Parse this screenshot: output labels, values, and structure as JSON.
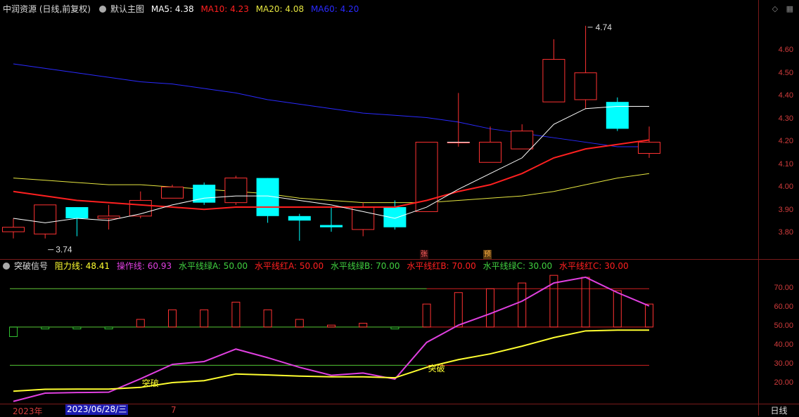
{
  "main_header": {
    "stock": "中润资源 (日线,前复权)",
    "template": "默认主图",
    "ma5": "MA5: 4.38",
    "ma10": "MA10: 4.23",
    "ma20": "MA20: 4.08",
    "ma60": "MA60: 4.20"
  },
  "indicator_header": {
    "name": "突破信号",
    "resistance": "阻力线: 48.41",
    "operation": "操作线: 60.93",
    "h_green_a": "水平线绿A: 50.00",
    "h_red_a": "水平线红A: 50.00",
    "h_green_b": "水平线绿B: 70.00",
    "h_red_b": "水平线红B: 70.00",
    "h_green_c": "水平线绿C: 30.00",
    "h_red_c": "水平线红C: 30.00"
  },
  "price_axis": [
    "4.60",
    "4.50",
    "4.40",
    "4.30",
    "4.20",
    "4.10",
    "4.00",
    "3.90",
    "3.80"
  ],
  "indicator_axis": [
    "70.00",
    "60.00",
    "50.00",
    "40.00",
    "30.00",
    "20.00"
  ],
  "annotations": {
    "high": "4.74",
    "low": "3.74",
    "breakout_1": "突破",
    "breakout_2": "突破"
  },
  "badges": {
    "rise": "张",
    "forecast": "预"
  },
  "bottom": {
    "year": "2023年",
    "cursor_date": "2023/06/28/三",
    "month": "7",
    "period": "日线"
  },
  "colors": {
    "ma5": "#ffffff",
    "ma10": "#ff2020",
    "ma20": "#e6e640",
    "ma60": "#2a2aff",
    "up": "#ff3232",
    "down": "#00ffff",
    "operation": "#e040e0",
    "resistance": "#ffff30"
  },
  "icons": {
    "settings": "diamond-icon",
    "layout": "grid-icon"
  },
  "chart_data": {
    "type": "candlestick",
    "candles": [
      {
        "o": 3.82,
        "h": 3.88,
        "l": 3.79,
        "c": 3.84
      },
      {
        "o": 3.81,
        "h": 3.94,
        "l": 3.79,
        "c": 3.94
      },
      {
        "o": 3.93,
        "h": 3.93,
        "l": 3.8,
        "c": 3.88
      },
      {
        "o": 3.88,
        "h": 3.94,
        "l": 3.83,
        "c": 3.89
      },
      {
        "o": 3.89,
        "h": 4.0,
        "l": 3.88,
        "c": 3.96
      },
      {
        "o": 3.97,
        "h": 4.03,
        "l": 3.97,
        "c": 4.02
      },
      {
        "o": 4.03,
        "h": 4.04,
        "l": 3.94,
        "c": 3.95
      },
      {
        "o": 3.95,
        "h": 4.07,
        "l": 3.94,
        "c": 4.06
      },
      {
        "o": 4.06,
        "h": 4.06,
        "l": 3.86,
        "c": 3.89
      },
      {
        "o": 3.89,
        "h": 3.9,
        "l": 3.78,
        "c": 3.87
      },
      {
        "o": 3.85,
        "h": 3.93,
        "l": 3.82,
        "c": 3.84
      },
      {
        "o": 3.83,
        "h": 3.95,
        "l": 3.8,
        "c": 3.93
      },
      {
        "o": 3.93,
        "h": 3.96,
        "l": 3.83,
        "c": 3.84
      },
      {
        "o": 3.91,
        "h": 4.22,
        "l": 3.91,
        "c": 4.22
      },
      {
        "o": 4.22,
        "h": 4.44,
        "l": 4.2,
        "c": 4.22
      },
      {
        "o": 4.13,
        "h": 4.29,
        "l": 4.13,
        "c": 4.22
      },
      {
        "o": 4.19,
        "h": 4.3,
        "l": 4.19,
        "c": 4.27
      },
      {
        "o": 4.4,
        "h": 4.68,
        "l": 4.4,
        "c": 4.59
      },
      {
        "o": 4.41,
        "h": 4.74,
        "l": 4.37,
        "c": 4.53
      },
      {
        "o": 4.4,
        "h": 4.42,
        "l": 4.27,
        "c": 4.28
      },
      {
        "o": 4.17,
        "h": 4.29,
        "l": 4.15,
        "c": 4.22
      }
    ],
    "ma5": [
      3.88,
      3.86,
      3.88,
      3.87,
      3.9,
      3.94,
      3.97,
      3.98,
      3.98,
      3.96,
      3.94,
      3.91,
      3.88,
      3.93,
      4.01,
      4.08,
      4.15,
      4.3,
      4.37,
      4.38,
      4.38
    ],
    "ma10": [
      4.0,
      3.98,
      3.96,
      3.95,
      3.94,
      3.93,
      3.92,
      3.93,
      3.93,
      3.93,
      3.93,
      3.93,
      3.93,
      3.96,
      4.0,
      4.03,
      4.08,
      4.15,
      4.19,
      4.21,
      4.23
    ],
    "ma20": [
      4.06,
      4.05,
      4.04,
      4.03,
      4.03,
      4.02,
      4.01,
      4.0,
      3.99,
      3.97,
      3.96,
      3.95,
      3.95,
      3.95,
      3.96,
      3.97,
      3.98,
      4.0,
      4.03,
      4.06,
      4.08
    ],
    "ma60": [
      4.57,
      4.55,
      4.53,
      4.51,
      4.49,
      4.48,
      4.46,
      4.44,
      4.41,
      4.39,
      4.37,
      4.35,
      4.34,
      4.33,
      4.31,
      4.28,
      4.26,
      4.24,
      4.22,
      4.2,
      4.2
    ],
    "ylim": [
      3.72,
      4.78
    ],
    "indicator": {
      "histogram": [
        45,
        49,
        49,
        49,
        54,
        59,
        59,
        63,
        59,
        54,
        51,
        52,
        49,
        62,
        68,
        70,
        73,
        77,
        76,
        69,
        62
      ],
      "operation_line": [
        11.2,
        15.5,
        15.8,
        16.0,
        23.0,
        30.5,
        32.0,
        38.5,
        34.0,
        29.0,
        24.8,
        26.0,
        22.8,
        42.0,
        51.0,
        57.0,
        63.5,
        73.0,
        76.0,
        68.0,
        61.0
      ],
      "resistance_line": [
        16.5,
        17.5,
        17.6,
        17.6,
        18.5,
        21.0,
        22.0,
        25.5,
        25.0,
        24.4,
        24.0,
        24.0,
        23.5,
        29.0,
        33.0,
        36.0,
        40.0,
        44.5,
        48.0,
        48.4,
        48.4
      ],
      "h_lines": [
        30,
        50,
        70
      ],
      "ylim": [
        10,
        80
      ]
    }
  }
}
